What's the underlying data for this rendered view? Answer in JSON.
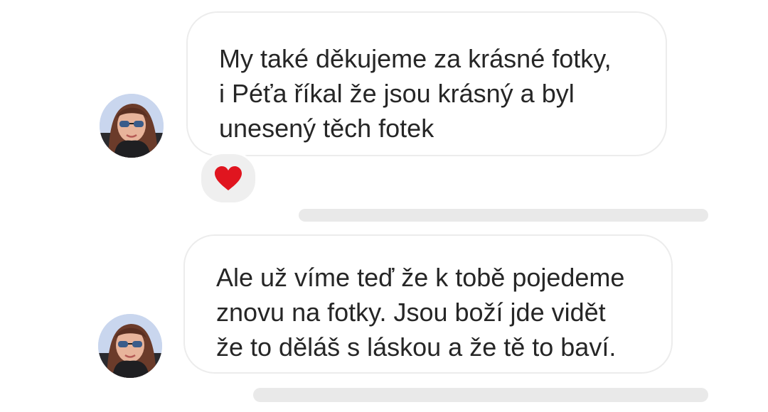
{
  "messages": [
    {
      "lines": [
        "My také děkujeme za krásné fotky,",
        "i Péťa říkal že jsou krásný a byl",
        "unesený těch fotek"
      ],
      "reaction_icon": "heart-icon"
    },
    {
      "lines": [
        "Ale už víme teď že k tobě pojedeme",
        "znovu na fotky. Jsou boží jde vidět",
        "že to děláš s láskou a že tě to baví."
      ]
    }
  ],
  "colors": {
    "text": "#262626",
    "bubble_border": "#ececec",
    "reaction_bg": "#efefef",
    "heart": "#e0151f",
    "placeholder_bar": "#e9e9e9"
  }
}
